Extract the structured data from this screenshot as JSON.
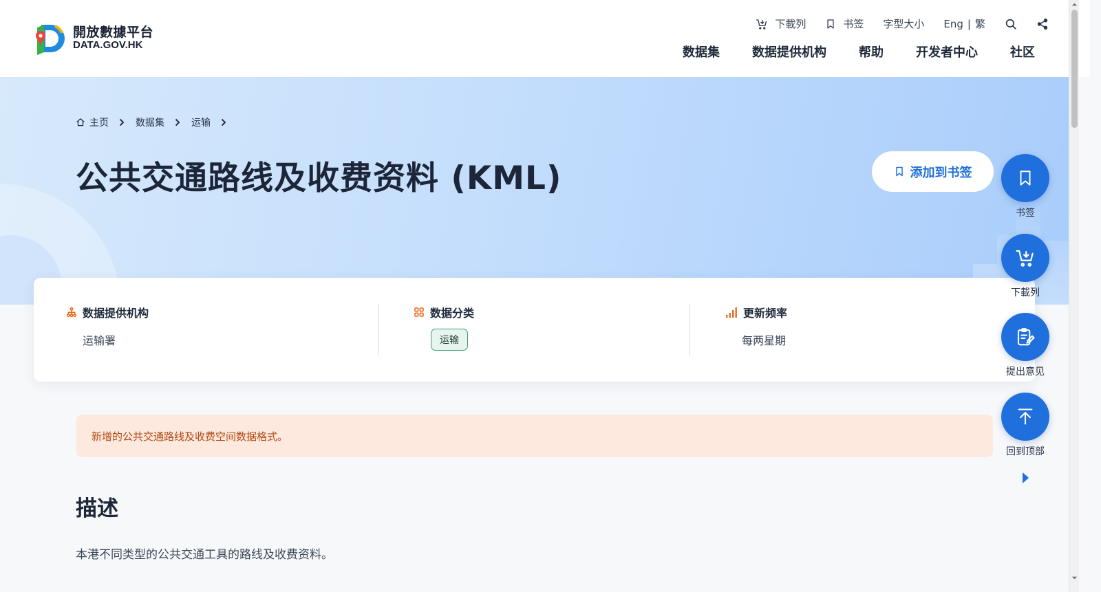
{
  "header": {
    "logo_cn": "開放數據平台",
    "logo_en": "DATA.GOV.HK",
    "utility": {
      "download_list": "下載列",
      "bookmark": "书签",
      "font_size": "字型大小",
      "lang_en": "Eng",
      "lang_sep": "|",
      "lang_tc": "繁"
    },
    "nav": [
      "数据集",
      "数据提供机构",
      "帮助",
      "开发者中心",
      "社区"
    ]
  },
  "breadcrumb": [
    "主页",
    "数据集",
    "运输"
  ],
  "page_title": "公共交通路线及收费资料 (KML)",
  "add_bookmark_label": "添加到书签",
  "info": {
    "provider_label": "数据提供机构",
    "provider_value": "运输署",
    "category_label": "数据分类",
    "category_value": "运输",
    "frequency_label": "更新频率",
    "frequency_value": "每两星期"
  },
  "notice": "新增的公共交通路线及收费空间数据格式。",
  "description": {
    "title": "描述",
    "body": "本港不同类型的公共交通工具的路线及收费资料。"
  },
  "side_actions": {
    "bookmark": "书签",
    "download_list": "下載列",
    "feedback": "提出意见",
    "back_to_top": "回到顶部"
  },
  "colors": {
    "primary": "#1f6fdc",
    "accent_orange": "#ef6a1f",
    "notice_bg": "#fde9dd",
    "tag_green": "#3f9a6a"
  }
}
